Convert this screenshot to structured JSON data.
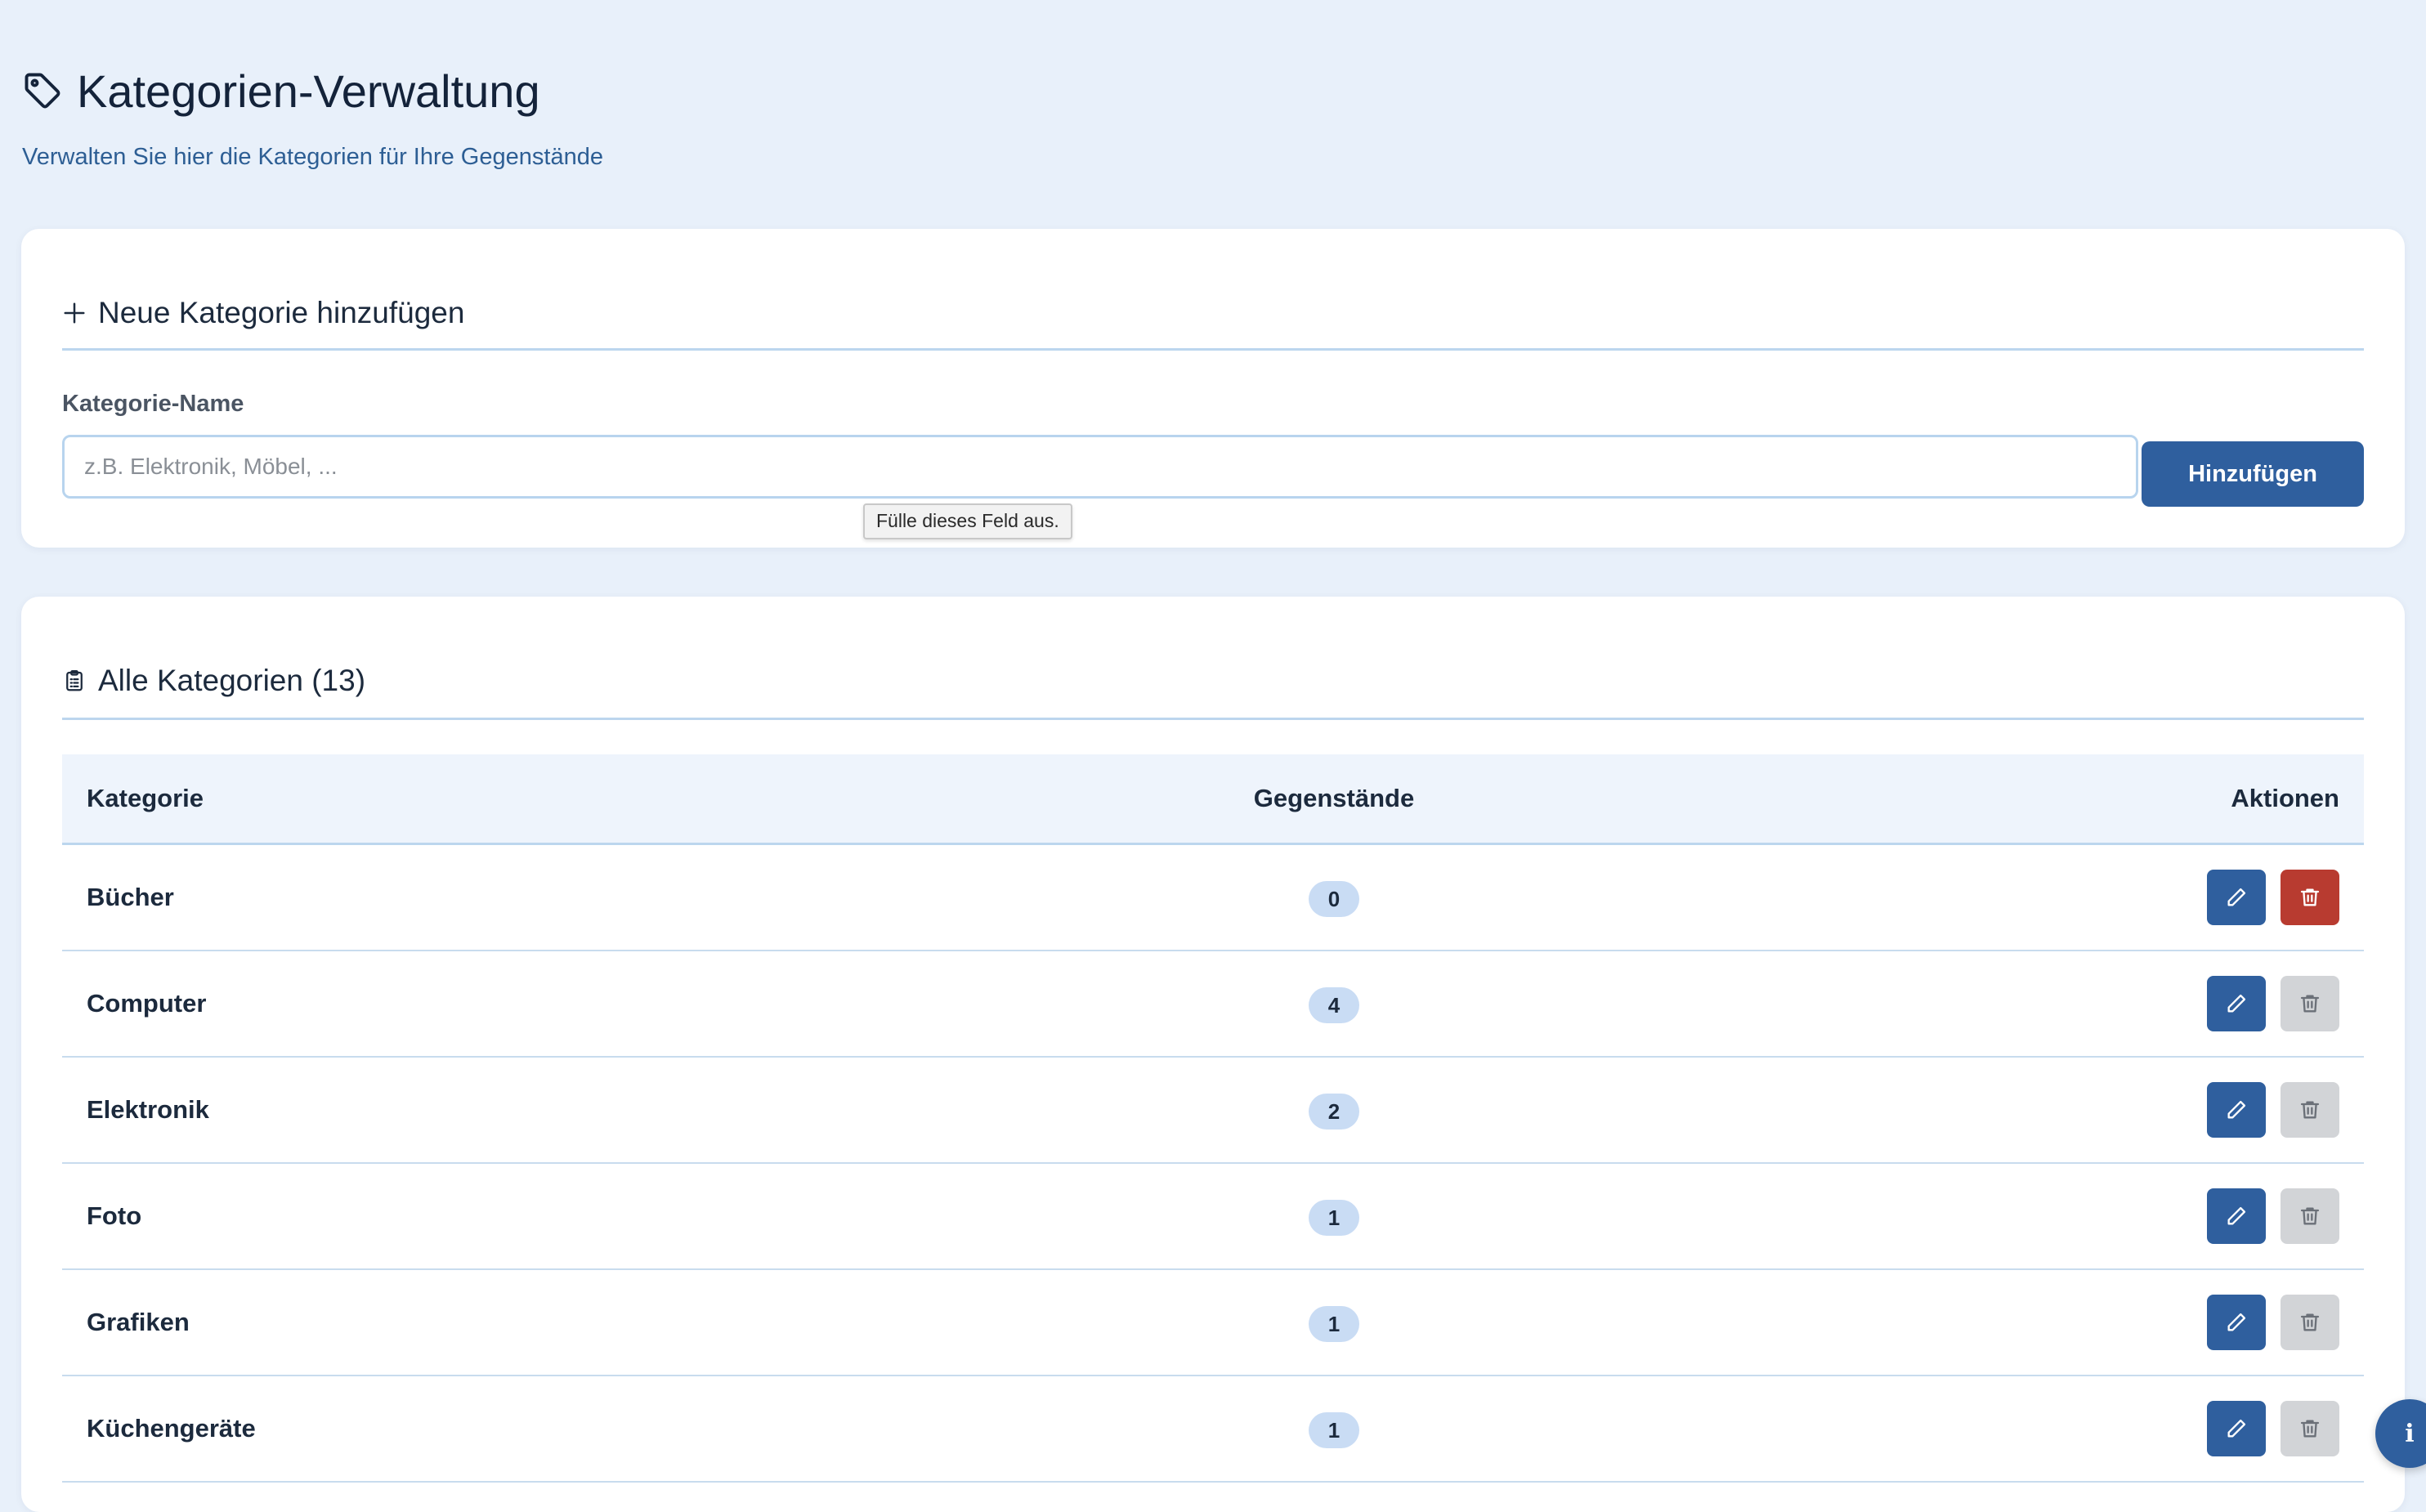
{
  "header": {
    "title": "Kategorien-Verwaltung",
    "subtitle": "Verwalten Sie hier die Kategorien für Ihre Gegenstände",
    "icon": "tag-icon"
  },
  "add_form": {
    "title": "Neue Kategorie hinzufügen",
    "field_label": "Kategorie-Name",
    "placeholder": "z.B. Elektronik, Möbel, ...",
    "value": "",
    "submit_label": "Hinzufügen",
    "validation_tooltip": "Fülle dieses Feld aus."
  },
  "list": {
    "title": "Alle Kategorien (13)",
    "columns": {
      "category": "Kategorie",
      "items": "Gegenstände",
      "actions": "Aktionen"
    },
    "rows": [
      {
        "name": "Bücher",
        "count": "0",
        "delete_enabled": true
      },
      {
        "name": "Computer",
        "count": "4",
        "delete_enabled": false
      },
      {
        "name": "Elektronik",
        "count": "2",
        "delete_enabled": false
      },
      {
        "name": "Foto",
        "count": "1",
        "delete_enabled": false
      },
      {
        "name": "Grafiken",
        "count": "1",
        "delete_enabled": false
      },
      {
        "name": "Küchengeräte",
        "count": "1",
        "delete_enabled": false
      }
    ]
  },
  "info_button": {
    "label": "i"
  },
  "colors": {
    "page_background": "#e8f0fa",
    "primary": "#2f5f9e",
    "danger": "#b83b30",
    "disabled": "#d2d4d7",
    "badge": "#c9dcf4"
  }
}
